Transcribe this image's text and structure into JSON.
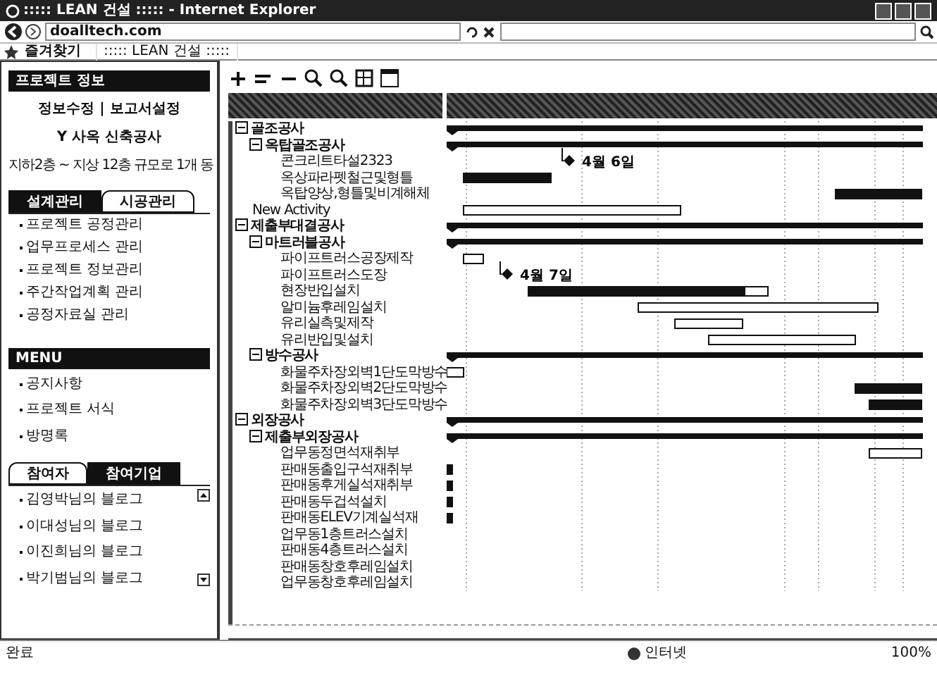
{
  "window": {
    "title": "::::: LEAN 건설 ::::: - Internet Explorer"
  },
  "address_bar": {
    "url": "doalltech.com"
  },
  "favorites": {
    "label": "즐겨찾기",
    "tab": "::::: LEAN 건설 :::::"
  },
  "sidebar": {
    "project_header": "프로젝트 정보",
    "project_links": "정보수정 | 보고서설정",
    "project_name": "Y 사옥 신축공사",
    "project_desc": "지하2층 ~ 지상 12층 규모로 1개 동",
    "tabs": [
      {
        "label": "설계관리",
        "selected": false
      },
      {
        "label": "시공관리",
        "selected": true
      }
    ],
    "items": [
      "프로젝트 공정관리",
      "업무프로세스 관리",
      "프로젝트 정보관리",
      "주간작업계획 관리",
      "공정자료실 관리"
    ],
    "menu_header": "MENU",
    "menu_items": [
      "공지사항",
      "프로젝트 서식",
      "방명록"
    ],
    "people_tabs": [
      {
        "label": "참여자",
        "selected": true
      },
      {
        "label": "참여기업",
        "selected": false
      }
    ],
    "people": [
      "김영박님의 블로그",
      "이대성님의 블로그",
      "이진희님의 블로그",
      "박기범님의 블로그"
    ]
  },
  "gantt": {
    "tasks": [
      {
        "label": "골조공사",
        "kind": "summary",
        "expanded": true,
        "children": [
          {
            "label": "옥탑골조공사",
            "kind": "summary",
            "expanded": true,
            "children": [
              {
                "label": "콘크리트타설2323",
                "kind": "task",
                "milestone": "4월 6일"
              },
              {
                "label": "옥상파라펫철근및형틀",
                "kind": "task"
              },
              {
                "label": "옥탑양상,형틀및비계해체",
                "kind": "task"
              }
            ]
          }
        ]
      },
      {
        "label": "New Activity",
        "kind": "task"
      },
      {
        "label": "제출부대결공사",
        "kind": "summary",
        "expanded": true,
        "children": [
          {
            "label": "마트러블공사",
            "kind": "summary",
            "expanded": true,
            "children": [
              {
                "label": "파이프트러스공장제작",
                "kind": "task"
              },
              {
                "label": "파이프트러스도장",
                "kind": "task",
                "milestone": "4월 7일"
              },
              {
                "label": "현장반입설치",
                "kind": "task"
              },
              {
                "label": "알미늄후레임설치",
                "kind": "task"
              },
              {
                "label": "유리실측및제작",
                "kind": "task"
              },
              {
                "label": "유리반입및설치",
                "kind": "task"
              }
            ]
          },
          {
            "label": "방수공사",
            "kind": "summary",
            "expanded": true,
            "children": [
              {
                "label": "화물주차장외벽1단도막방수",
                "kind": "task"
              },
              {
                "label": "화물주차장외벽2단도막방수",
                "kind": "task"
              },
              {
                "label": "화물주차장외벽3단도막방수",
                "kind": "task"
              }
            ]
          }
        ]
      },
      {
        "label": "외장공사",
        "kind": "summary",
        "expanded": true,
        "children": [
          {
            "label": "제출부외장공사",
            "kind": "summary",
            "expanded": true,
            "children": [
              {
                "label": "업무동정면석재취부",
                "kind": "task"
              },
              {
                "label": "판매동출입구석재취부",
                "kind": "task"
              },
              {
                "label": "판매동후게실석재취부",
                "kind": "task"
              },
              {
                "label": "판매동두겁석설치",
                "kind": "task"
              },
              {
                "label": "판매동ELEV기계실석재",
                "kind": "task"
              },
              {
                "label": "업무동1층트러스설치",
                "kind": "task"
              },
              {
                "label": "판매동4층트러스설치",
                "kind": "task"
              },
              {
                "label": "판매동창호후레임설치",
                "kind": "task"
              },
              {
                "label": "업무동창호후레임설치",
                "kind": "task"
              }
            ]
          }
        ]
      }
    ]
  },
  "status_bar": {
    "text": "완료",
    "zone": "인터넷",
    "zoom": "100%"
  }
}
